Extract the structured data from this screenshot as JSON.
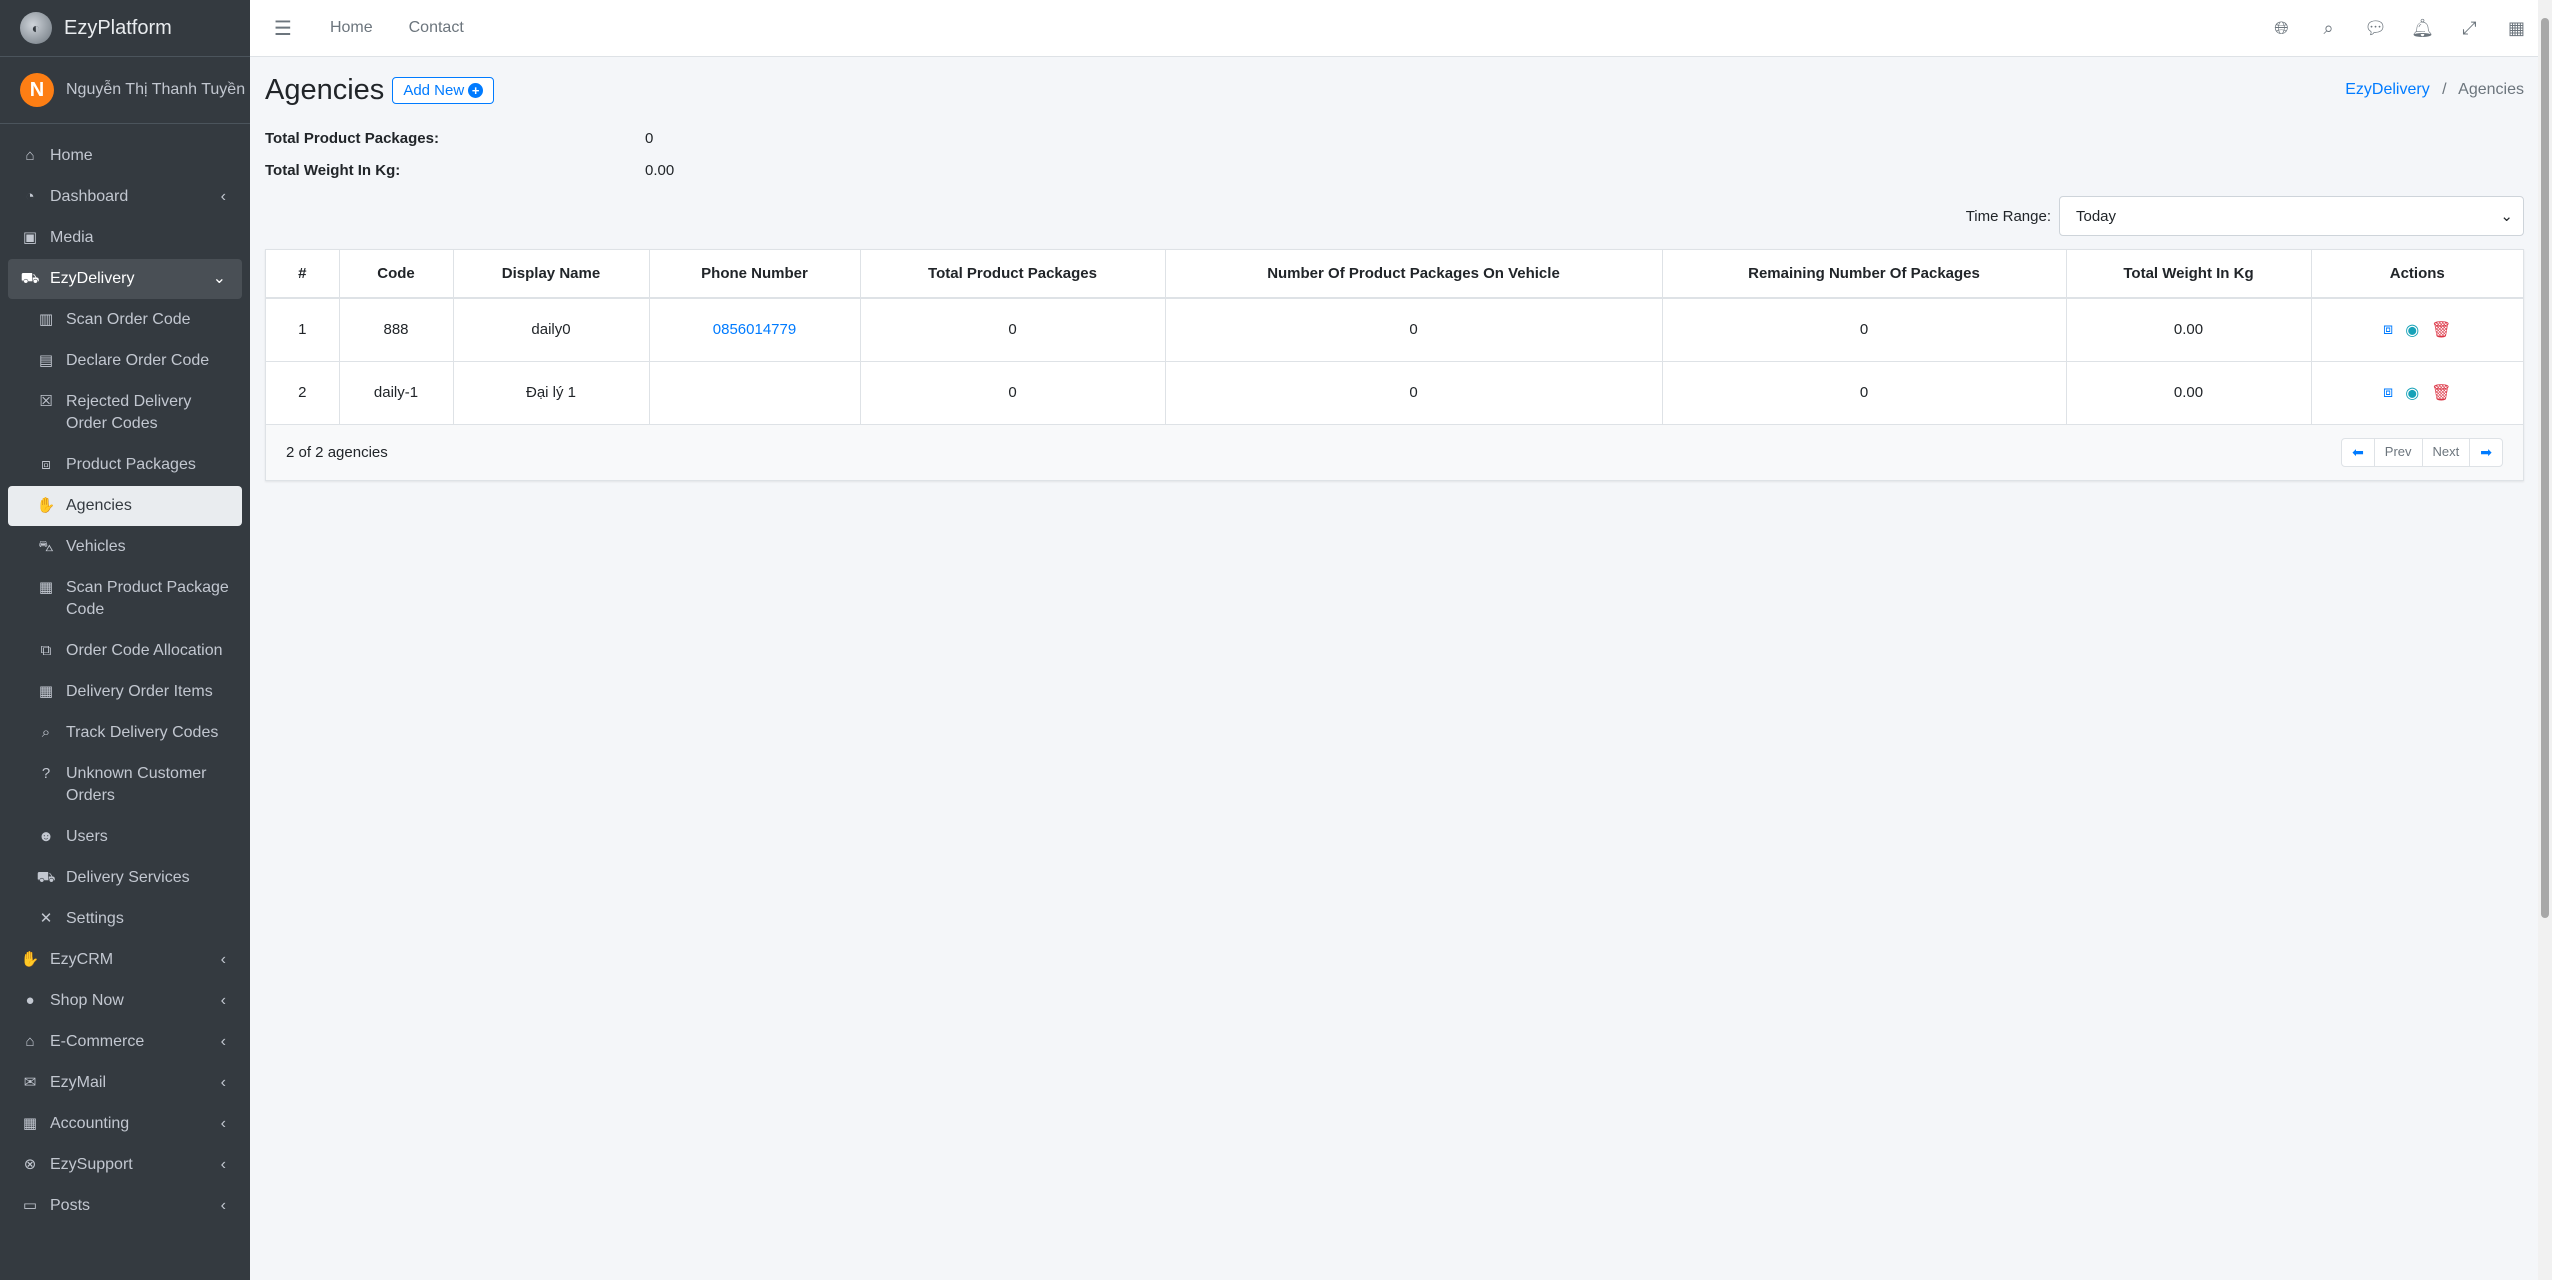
{
  "brand": {
    "name": "EzyPlatform"
  },
  "user": {
    "initial": "N",
    "name": "Nguyễn Thị Thanh Tuyền"
  },
  "sidebar": {
    "items": [
      {
        "label": "Home",
        "icon": "home-icon"
      },
      {
        "label": "Dashboard",
        "icon": "dashboard-icon"
      },
      {
        "label": "Media",
        "icon": "image-icon"
      },
      {
        "label": "EzyDelivery",
        "icon": "truck-icon"
      }
    ],
    "delivery_sub": [
      {
        "label": "Scan Order Code"
      },
      {
        "label": "Declare Order Code"
      },
      {
        "label": "Rejected Delivery Order Codes"
      },
      {
        "label": "Product Packages"
      },
      {
        "label": "Agencies"
      },
      {
        "label": "Vehicles"
      },
      {
        "label": "Scan Product Package Code"
      },
      {
        "label": "Order Code Allocation"
      },
      {
        "label": "Delivery Order Items"
      },
      {
        "label": "Track Delivery Codes"
      },
      {
        "label": "Unknown Customer Orders"
      },
      {
        "label": "Users"
      },
      {
        "label": "Delivery Services"
      },
      {
        "label": "Settings"
      }
    ],
    "bottom_items": [
      {
        "label": "EzyCRM"
      },
      {
        "label": "Shop Now"
      },
      {
        "label": "E-Commerce"
      },
      {
        "label": "EzyMail"
      },
      {
        "label": "Accounting"
      },
      {
        "label": "EzySupport"
      },
      {
        "label": "Posts"
      }
    ]
  },
  "topbar": {
    "links": [
      "Home",
      "Contact"
    ]
  },
  "page": {
    "title": "Agencies",
    "add_new": "Add New",
    "breadcrumb": {
      "parent": "EzyDelivery",
      "current": "Agencies"
    }
  },
  "stats": {
    "packages_label": "Total Product Packages:",
    "packages_value": "0",
    "weight_label": "Total Weight In Kg:",
    "weight_value": "0.00"
  },
  "time_range": {
    "label": "Time Range:",
    "value": "Today"
  },
  "table": {
    "headers": [
      "#",
      "Code",
      "Display Name",
      "Phone Number",
      "Total Product Packages",
      "Number Of Product Packages On Vehicle",
      "Remaining Number Of Packages",
      "Total Weight In Kg",
      "Actions"
    ],
    "rows": [
      {
        "num": "1",
        "code": "888",
        "name": "daily0",
        "phone": "0856014779",
        "total": "0",
        "on_vehicle": "0",
        "remaining": "0",
        "weight": "0.00"
      },
      {
        "num": "2",
        "code": "daily-1",
        "name": "Đại lý 1",
        "phone": "",
        "total": "0",
        "on_vehicle": "0",
        "remaining": "0",
        "weight": "0.00"
      }
    ],
    "footer": "2 of 2 agencies",
    "pager": {
      "prev": "Prev",
      "next": "Next"
    }
  },
  "colors": {
    "accent": "#007bff",
    "sidebar": "#343a40",
    "danger": "#dc3545",
    "info": "#17a2b8"
  }
}
